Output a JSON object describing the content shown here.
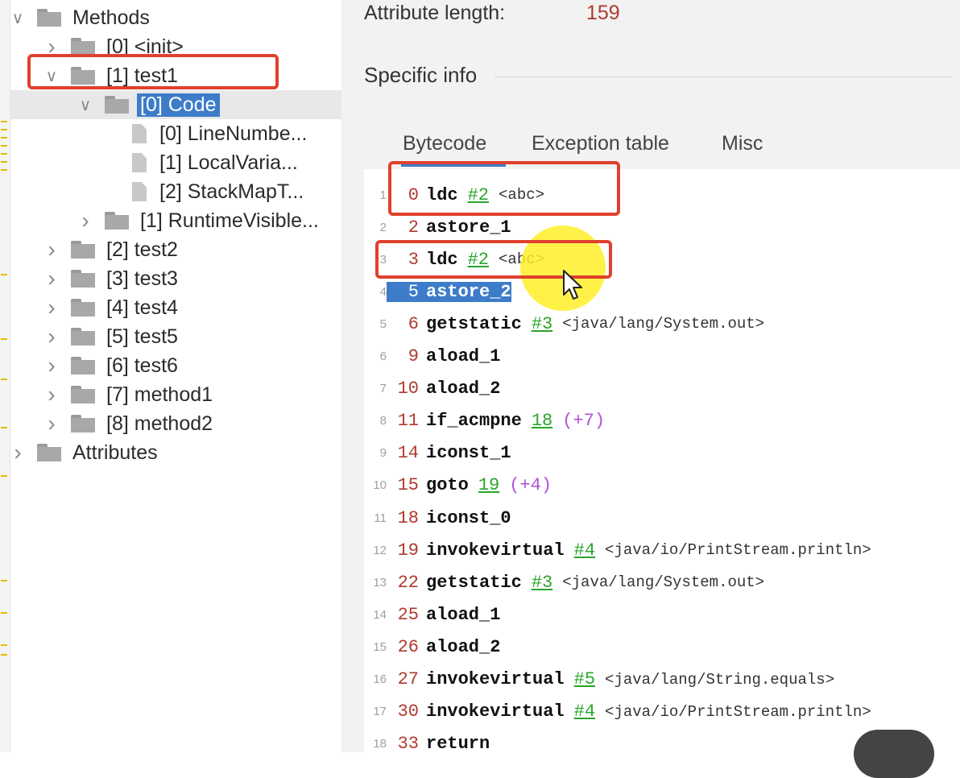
{
  "tree": {
    "rows": [
      {
        "label": "Methods",
        "arrow": "expanded",
        "icon": "folder-icon",
        "level": 0
      },
      {
        "label": "[0] <init>",
        "arrow": "collapsed",
        "icon": "folder-icon",
        "level": 1
      },
      {
        "label": "[1] test1",
        "arrow": "expanded",
        "icon": "folder-icon",
        "level": 1
      },
      {
        "label": "[0] Code",
        "arrow": "expanded",
        "icon": "folder-icon",
        "level": 2,
        "selected": true
      },
      {
        "label": "[0] LineNumbe...",
        "arrow": "none",
        "icon": "file-icon",
        "level": 3
      },
      {
        "label": "[1] LocalVaria...",
        "arrow": "none",
        "icon": "file-icon",
        "level": 3
      },
      {
        "label": "[2] StackMapT...",
        "arrow": "none",
        "icon": "file-icon",
        "level": 3
      },
      {
        "label": "[1] RuntimeVisible...",
        "arrow": "collapsed",
        "icon": "folder-icon",
        "level": 2
      },
      {
        "label": "[2] test2",
        "arrow": "collapsed",
        "icon": "folder-icon",
        "level": 1
      },
      {
        "label": "[3] test3",
        "arrow": "collapsed",
        "icon": "folder-icon",
        "level": 1
      },
      {
        "label": "[4] test4",
        "arrow": "collapsed",
        "icon": "folder-icon",
        "level": 1
      },
      {
        "label": "[5] test5",
        "arrow": "collapsed",
        "icon": "folder-icon",
        "level": 1
      },
      {
        "label": "[6] test6",
        "arrow": "collapsed",
        "icon": "folder-icon",
        "level": 1
      },
      {
        "label": "[7] method1",
        "arrow": "collapsed",
        "icon": "folder-icon",
        "level": 1
      },
      {
        "label": "[8] method2",
        "arrow": "collapsed",
        "icon": "folder-icon",
        "level": 1
      },
      {
        "label": "Attributes",
        "arrow": "collapsed",
        "icon": "folder-icon",
        "level": 0
      }
    ]
  },
  "detail": {
    "attr_length_label": "Attribute length:",
    "attr_length_value": "159",
    "section_title": "Specific info",
    "tabs": [
      {
        "label": "Bytecode",
        "active": true
      },
      {
        "label": "Exception table",
        "active": false
      },
      {
        "label": "Misc",
        "active": false
      }
    ]
  },
  "bytecode": [
    {
      "line": "1",
      "offset": "0",
      "op": "ldc",
      "ref": "#2",
      "comment": "<abc>"
    },
    {
      "line": "2",
      "offset": "2",
      "op": "astore_1"
    },
    {
      "line": "3",
      "offset": "3",
      "op": "ldc",
      "ref": "#2",
      "comment": "<abc>"
    },
    {
      "line": "4",
      "offset": "5",
      "op": "astore_2",
      "highlighted": true
    },
    {
      "line": "5",
      "offset": "6",
      "op": "getstatic",
      "ref": "#3",
      "comment": "<java/lang/System.out>"
    },
    {
      "line": "6",
      "offset": "9",
      "op": "aload_1"
    },
    {
      "line": "7",
      "offset": "10",
      "op": "aload_2"
    },
    {
      "line": "8",
      "offset": "11",
      "op": "if_acmpne",
      "ref": "18",
      "jump": "(+7)"
    },
    {
      "line": "9",
      "offset": "14",
      "op": "iconst_1"
    },
    {
      "line": "10",
      "offset": "15",
      "op": "goto",
      "ref": "19",
      "jump": "(+4)"
    },
    {
      "line": "11",
      "offset": "18",
      "op": "iconst_0"
    },
    {
      "line": "12",
      "offset": "19",
      "op": "invokevirtual",
      "ref": "#4",
      "comment": "<java/io/PrintStream.println>"
    },
    {
      "line": "13",
      "offset": "22",
      "op": "getstatic",
      "ref": "#3",
      "comment": "<java/lang/System.out>"
    },
    {
      "line": "14",
      "offset": "25",
      "op": "aload_1"
    },
    {
      "line": "15",
      "offset": "26",
      "op": "aload_2"
    },
    {
      "line": "16",
      "offset": "27",
      "op": "invokevirtual",
      "ref": "#5",
      "comment": "<java/lang/String.equals>"
    },
    {
      "line": "17",
      "offset": "30",
      "op": "invokevirtual",
      "ref": "#4",
      "comment": "<java/io/PrintStream.println>"
    },
    {
      "line": "18",
      "offset": "33",
      "op": "return"
    }
  ],
  "colors": {
    "selection": "#3d7cc9",
    "offset": "#b03a2e",
    "reference": "#2aa52a",
    "jump": "#b14fd8",
    "annotation": "#e0402e",
    "cursor_halo": "#ffee28"
  }
}
